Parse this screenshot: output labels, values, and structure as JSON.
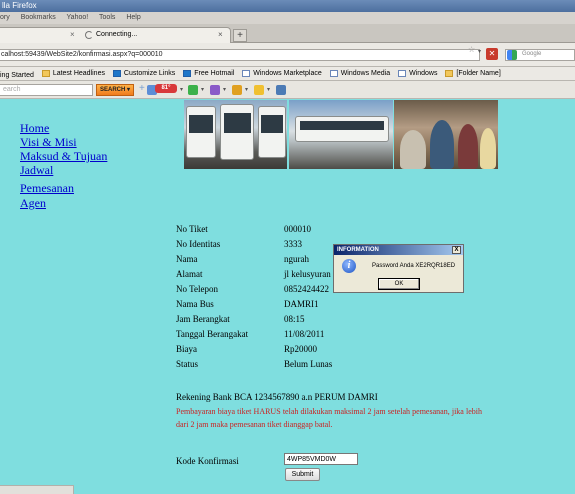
{
  "window": {
    "title": "lla Firefox"
  },
  "menu": {
    "items": [
      "ory",
      "Bookmarks",
      "Yahoo!",
      "Tools",
      "Help"
    ]
  },
  "tab": {
    "title": "Connecting...",
    "close": "×",
    "new_tab": "+"
  },
  "address": {
    "url": "calhost:59439/WebSite2/konfirmasi.aspx?q=000010",
    "search_placeholder": "Google"
  },
  "bookmarks": [
    {
      "label": "ing Started",
      "icon": "page-icon"
    },
    {
      "label": "Latest Headlines",
      "icon": "folder-icon"
    },
    {
      "label": "Customize Links",
      "icon": "windows-icon"
    },
    {
      "label": "Free Hotmail",
      "icon": "windows-icon"
    },
    {
      "label": "Windows Marketplace",
      "icon": "page-icon"
    },
    {
      "label": "Windows Media",
      "icon": "page-icon"
    },
    {
      "label": "Windows",
      "icon": "page-icon"
    },
    {
      "label": "[Folder Name]",
      "icon": "folder-icon"
    }
  ],
  "toolbar": {
    "search_placeholder": "earch",
    "search_button": "SEARCH ▾",
    "badge": "81°"
  },
  "nav": [
    "Home",
    "Visi & Misi",
    "Maksud & Tujuan",
    "Jadwal",
    "Pemesanan",
    "Agen"
  ],
  "ticket": {
    "fields": [
      {
        "label": "No Tiket",
        "value": "000010"
      },
      {
        "label": "No Identitas",
        "value": "3333"
      },
      {
        "label": "Nama",
        "value": "ngurah"
      },
      {
        "label": "Alamat",
        "value": "jl kelusyuran"
      },
      {
        "label": "No Telepon",
        "value": "0852424422"
      },
      {
        "label": "Nama Bus",
        "value": "DAMRI1"
      },
      {
        "label": "Jam Berangkat",
        "value": "08:15"
      },
      {
        "label": "Tanggal Berangakat",
        "value": "11/08/2011"
      },
      {
        "label": "Biaya",
        "value": "Rp20000"
      },
      {
        "label": "Status",
        "value": "Belum Lunas"
      }
    ]
  },
  "bank_info": "Rekening Bank BCA 1234567890 a.n PERUM DAMRI",
  "warning": "Pembayaran biaya tiket HARUS telah dilakukan maksimal 2 jam setelah pemesanan, jika lebih dari 2 jam maka pemesanan tiket dianggap batal.",
  "confirm": {
    "label": "Kode Konfirmasi",
    "value": "4WP85VMD0W",
    "submit": "Submit"
  },
  "dialog": {
    "title": "INFORMATION",
    "close": "X",
    "message": "Password Anda XE2RQR18ED",
    "ok": "OK",
    "icon_glyph": "i"
  },
  "colors": {
    "page_bg": "#7fdedf",
    "link": "#0000cc",
    "warning": "#cc2020"
  }
}
